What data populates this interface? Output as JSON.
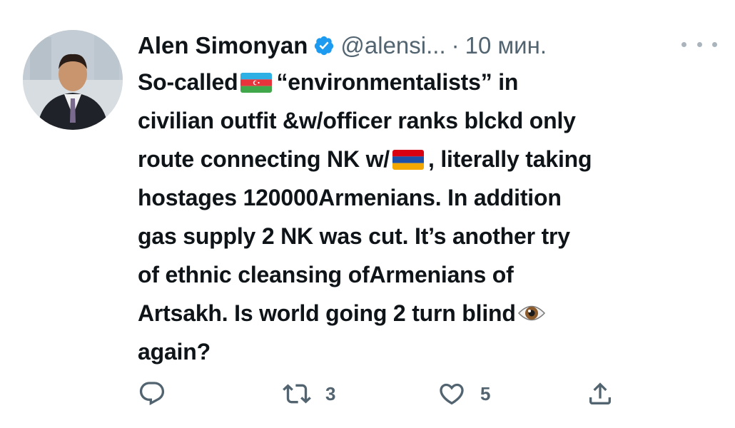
{
  "tweet": {
    "author_name": "Alen Simonyan",
    "author_handle": "@alensi...",
    "separator": "·",
    "time": "10 мин.",
    "text_lines": [
      "So-called",
      "“environmentalists” in",
      "civilian outfit &w/officer ranks blckd only",
      "route connecting NK w/",
      ", literally taking",
      "hostages 120000Armenians. In addition",
      "gas supply 2 NK was cut. It’s another try",
      "of ethnic cleansing ofArmenians of",
      "Artsakh. Is world going 2 turn blind",
      "again?"
    ],
    "emojis": [
      "flag-azerbaijan",
      "flag-armenia",
      "eye"
    ]
  },
  "actions": {
    "retweet_count": "3",
    "like_count": "5"
  },
  "icons": {
    "verified": "verified-badge-icon",
    "more": "more-options-icon",
    "reply": "reply-icon",
    "retweet": "retweet-icon",
    "like": "heart-icon",
    "share": "share-icon"
  },
  "colors": {
    "accent": "#1d9bf0",
    "text": "#0f1419",
    "muted": "#536471"
  }
}
